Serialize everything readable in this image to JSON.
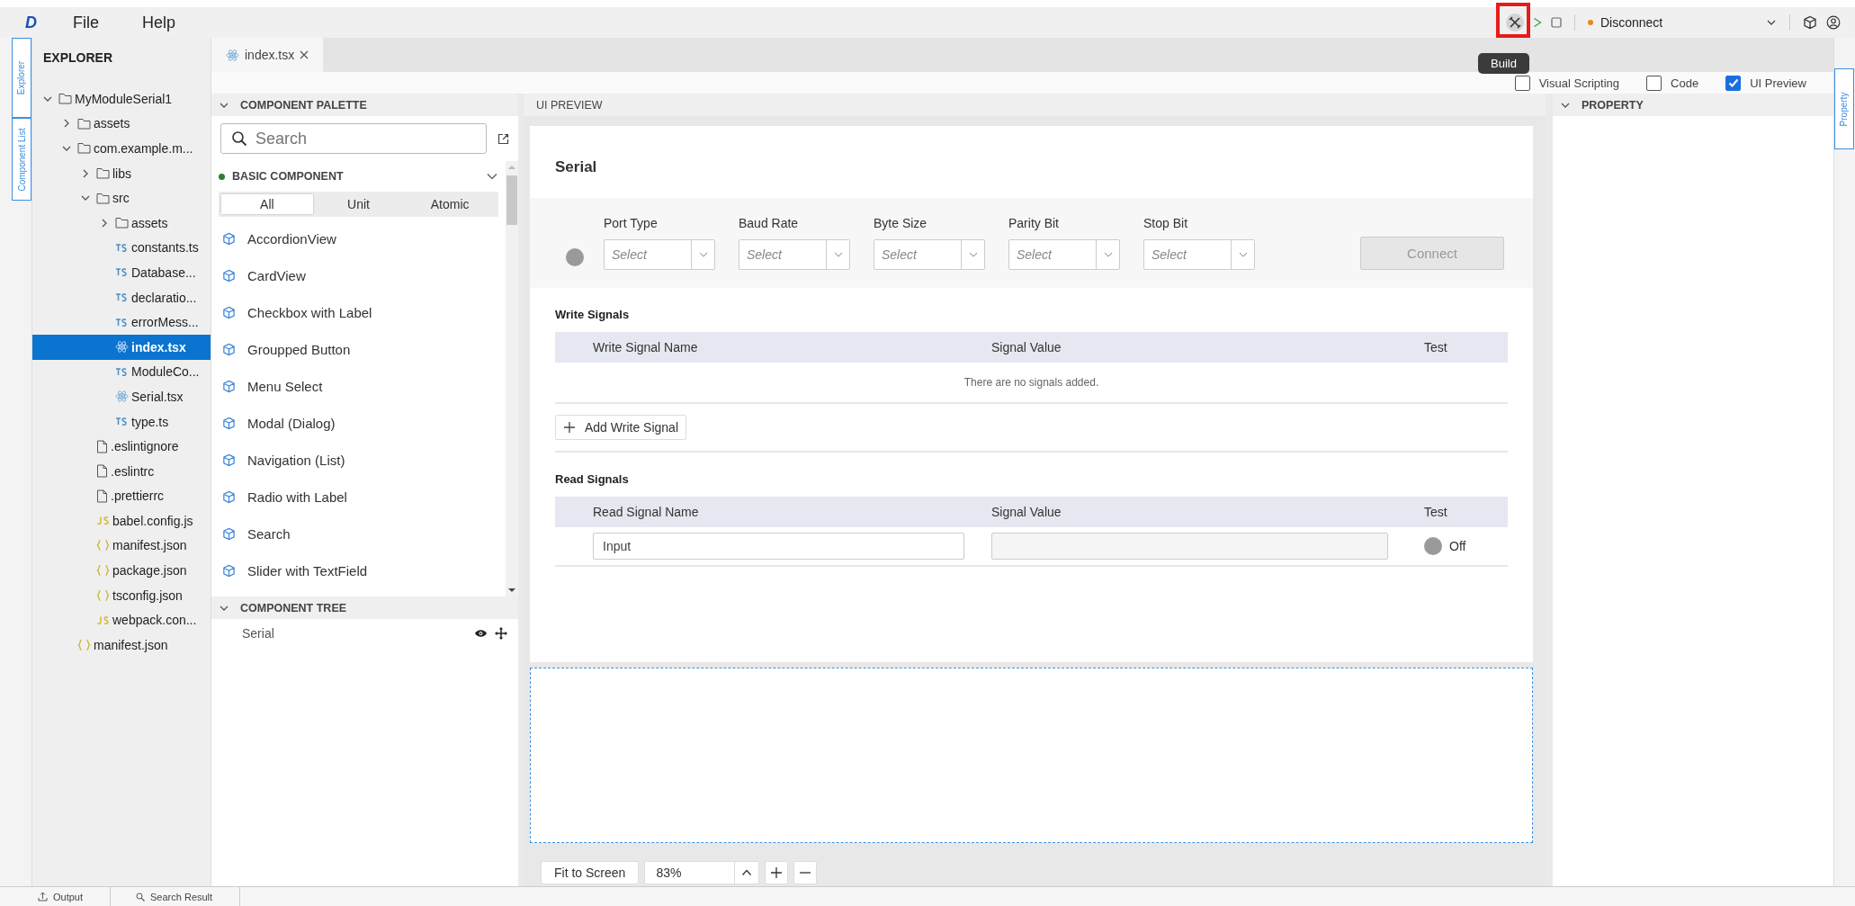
{
  "app_logo": "D",
  "menu_items": [
    "File",
    "Help"
  ],
  "toolbar": {
    "build_tooltip": "Build",
    "connection": {
      "label": "Disconnect",
      "connected": false
    }
  },
  "side_tabs_left": [
    "Explorer",
    "Component List"
  ],
  "side_tabs_right": [
    "Property"
  ],
  "explorer": {
    "title": "EXPLORER",
    "tree": [
      {
        "label": "MyModuleSerial1",
        "kind": "folder",
        "expanded": true,
        "selected": false,
        "children": [
          {
            "label": "assets",
            "kind": "folder",
            "expanded": false,
            "selected": false
          },
          {
            "label": "com.example.m...",
            "kind": "folder",
            "expanded": true,
            "selected": false,
            "children": [
              {
                "label": "libs",
                "kind": "folder",
                "expanded": false,
                "selected": false
              },
              {
                "label": "src",
                "kind": "folder",
                "expanded": true,
                "selected": false,
                "children": [
                  {
                    "label": "assets",
                    "kind": "folder",
                    "expanded": false,
                    "selected": false
                  },
                  {
                    "label": "constants.ts",
                    "kind": "ts",
                    "selected": false
                  },
                  {
                    "label": "Database...",
                    "kind": "ts",
                    "selected": false
                  },
                  {
                    "label": "declaratio...",
                    "kind": "ts",
                    "selected": false
                  },
                  {
                    "label": "errorMess...",
                    "kind": "ts",
                    "selected": false
                  },
                  {
                    "label": "index.tsx",
                    "kind": "react",
                    "selected": true
                  },
                  {
                    "label": "ModuleCo...",
                    "kind": "ts",
                    "selected": false
                  },
                  {
                    "label": "Serial.tsx",
                    "kind": "react",
                    "selected": false
                  },
                  {
                    "label": "type.ts",
                    "kind": "ts",
                    "selected": false
                  }
                ]
              },
              {
                "label": ".eslintignore",
                "kind": "file",
                "selected": false
              },
              {
                "label": ".eslintrc",
                "kind": "file",
                "selected": false
              },
              {
                "label": ".prettierrc",
                "kind": "file",
                "selected": false
              },
              {
                "label": "babel.config.js",
                "kind": "js",
                "selected": false
              },
              {
                "label": "manifest.json",
                "kind": "json",
                "selected": false
              },
              {
                "label": "package.json",
                "kind": "json",
                "selected": false
              },
              {
                "label": "tsconfig.json",
                "kind": "json",
                "selected": false
              },
              {
                "label": "webpack.con...",
                "kind": "js",
                "selected": false
              }
            ]
          },
          {
            "label": "manifest.json",
            "kind": "json",
            "selected": false
          }
        ]
      }
    ]
  },
  "editor_tabs": [
    {
      "label": "index.tsx",
      "selected": true
    }
  ],
  "view_toggles": [
    {
      "label": "Visual Scripting",
      "checked": false
    },
    {
      "label": "Code",
      "checked": false
    },
    {
      "label": "UI Preview",
      "checked": true
    }
  ],
  "palette": {
    "title": "COMPONENT PALETTE",
    "search_placeholder": "Search",
    "category": "BASIC COMPONENT",
    "filters": [
      {
        "label": "All",
        "selected": true
      },
      {
        "label": "Unit",
        "selected": false
      },
      {
        "label": "Atomic",
        "selected": false
      }
    ],
    "components": [
      "AccordionView",
      "CardView",
      "Checkbox with Label",
      "Groupped Button",
      "Menu Select",
      "Modal (Dialog)",
      "Navigation (List)",
      "Radio with Label",
      "Search",
      "Slider with TextField"
    ]
  },
  "component_tree": {
    "title": "COMPONENT TREE",
    "items": [
      "Serial"
    ]
  },
  "preview": {
    "title": "UI PREVIEW",
    "card": {
      "title": "Serial",
      "connected": false,
      "settings": [
        {
          "label": "Port Type",
          "placeholder": "Select"
        },
        {
          "label": "Baud Rate",
          "placeholder": "Select"
        },
        {
          "label": "Byte Size",
          "placeholder": "Select"
        },
        {
          "label": "Parity Bit",
          "placeholder": "Select"
        },
        {
          "label": "Stop Bit",
          "placeholder": "Select"
        }
      ],
      "connect_button": {
        "label": "Connect",
        "disabled": true
      },
      "write_signals": {
        "title": "Write Signals",
        "columns": [
          "Write Signal Name",
          "Signal Value",
          "Test"
        ],
        "empty_message": "There are no signals added.",
        "add_button": "Add Write Signal"
      },
      "read_signals": {
        "title": "Read Signals",
        "columns": [
          "Read Signal Name",
          "Signal Value",
          "Test"
        ],
        "rows": [
          {
            "name": "Input",
            "on": false,
            "state_label": "Off"
          }
        ]
      }
    },
    "zoom": {
      "fit_label": "Fit to Screen",
      "value": "83%"
    }
  },
  "property": {
    "title": "PROPERTY"
  },
  "bottom_tabs": [
    "Output",
    "Search Result"
  ]
}
